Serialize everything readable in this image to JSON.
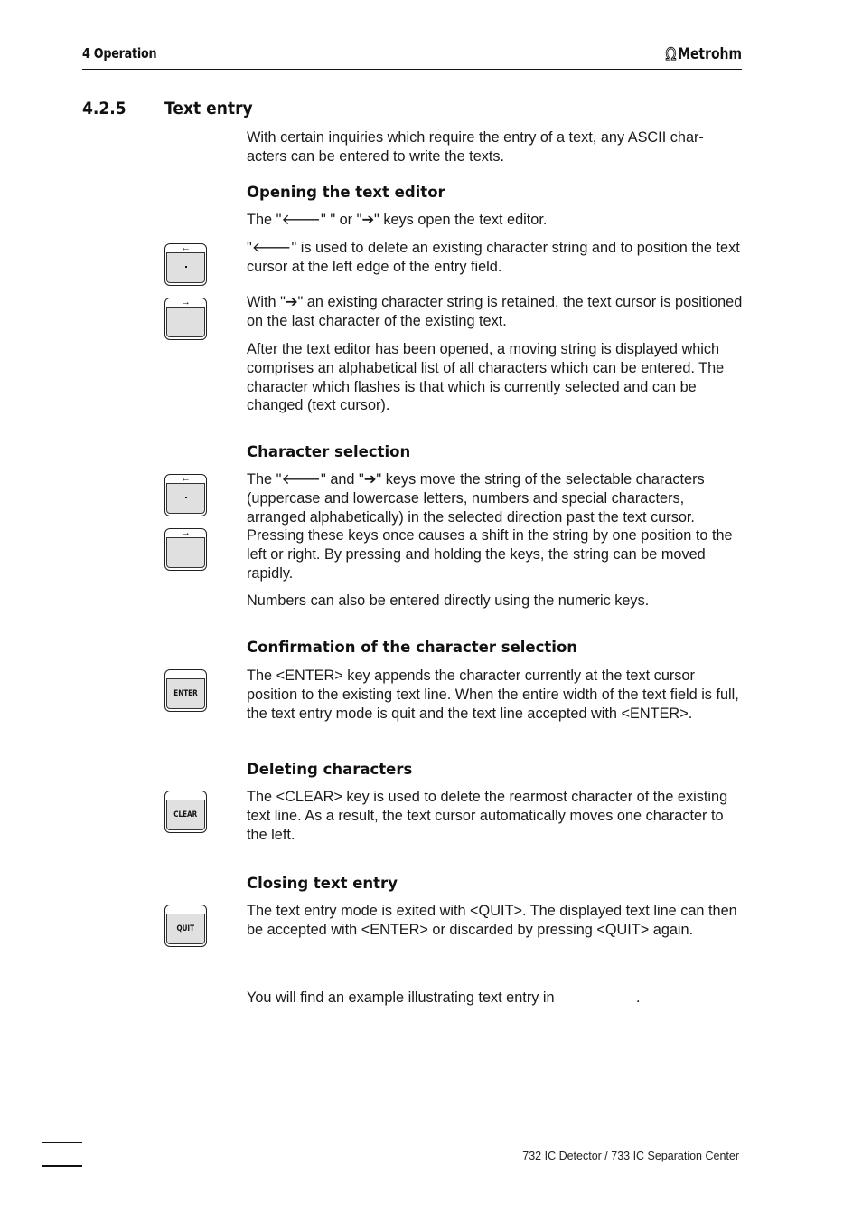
{
  "header": {
    "chapter": "4  Operation",
    "brand_symbol": "Ω",
    "brand_name": "Metrohm"
  },
  "section": {
    "number": "4.2.5",
    "title": "Text entry"
  },
  "intro": "With certain inquiries which require the entry of a text, any ASCII char-acters can be entered to write the texts.",
  "opening": {
    "heading": "Opening the text editor",
    "p1": "The \"🡐\" \" or \"➔\" keys open the text editor.",
    "p2": "\"🡐\" is used to delete an existing character string and to position the text cursor at the left edge of the entry field.",
    "p3": "With \"➔\" an existing character string is retained, the text cursor is positioned on the last character of the existing text.",
    "p4": "After the text editor has been opened, a moving string is displayed which comprises an alphabetical list of all characters which can be entered. The character which flashes is that which is currently selected and can be changed (text cursor)."
  },
  "selection": {
    "heading": "Character selection",
    "p1": "The \"🡐\" and \"➔\" keys move the string of the selectable characters (uppercase and lowercase letters, numbers and special characters, arranged alphabetically) in the selected direction past the text cursor. Pressing these keys once causes a shift in the string by one position to the left or right. By pressing and holding the keys, the string can be moved rapidly.",
    "p2": "Numbers can also be entered directly using the numeric keys."
  },
  "confirmation": {
    "heading": "Confirmation of the character selection",
    "p1": "The <ENTER> key appends the character currently at the text cursor position to the existing text line. When the entire width of the text field is full, the text entry mode is quit and the text line accepted with <ENTER>."
  },
  "deleting": {
    "heading": "Deleting characters",
    "p1": "The <CLEAR> key is used to delete the rearmost character of the existing text line. As a result, the text cursor automatically moves one character to the left."
  },
  "closing": {
    "heading": "Closing text entry",
    "p1": "The text entry mode is exited with <QUIT>. The displayed text line can then be accepted with <ENTER> or discarded by pressing <QUIT> again."
  },
  "example_note": "You will find an example illustrating text entry in                    .",
  "keys": {
    "left_arrow": "←",
    "right_arrow": "→",
    "enter": "ENTER",
    "clear": "CLEAR",
    "quit": "QUIT"
  },
  "footer": {
    "product": "732 IC Detector / 733 IC Separation Center"
  }
}
